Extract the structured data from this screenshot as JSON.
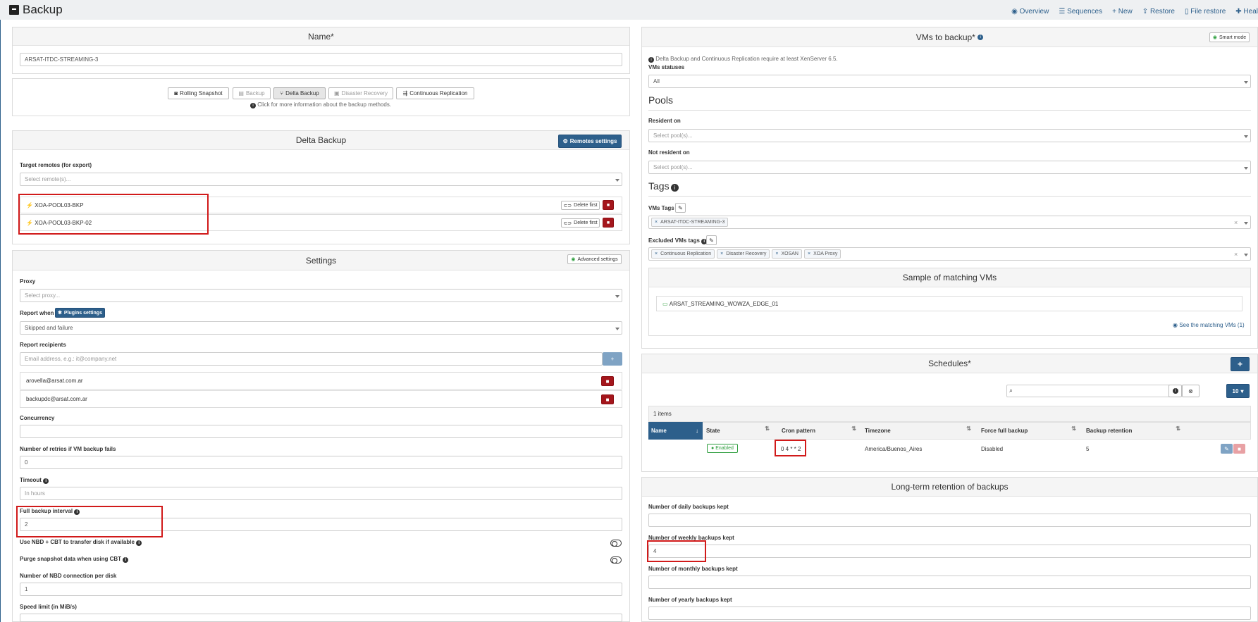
{
  "app": {
    "title": "Backup"
  },
  "nav": {
    "overview": "Overview",
    "sequences": "Sequences",
    "new": "New",
    "restore": "Restore",
    "file_restore": "File restore",
    "health": "Heal"
  },
  "name_panel": {
    "title": "Name*",
    "value": "ARSAT-ITDC-STREAMING-3"
  },
  "modes": {
    "rolling_snapshot": "Rolling Snapshot",
    "backup": "Backup",
    "delta_backup": "Delta Backup",
    "disaster_recovery": "Disaster Recovery",
    "continuous_replication": "Continuous Replication",
    "hint": "Click for more information about the backup methods."
  },
  "delta": {
    "title": "Delta Backup",
    "remotes_settings": "Remotes settings",
    "target_label": "Target remotes (for export)",
    "target_placeholder": "Select remote(s)...",
    "remotes": [
      {
        "name": "XOA-POOL03-BKP",
        "delete_first": "Delete first"
      },
      {
        "name": "XOA-POOL03-BKP-02",
        "delete_first": "Delete first"
      }
    ]
  },
  "settings": {
    "title": "Settings",
    "advanced": "Advanced settings",
    "proxy_label": "Proxy",
    "proxy_placeholder": "Select proxy...",
    "report_when_label": "Report when",
    "plugins_settings": "Plugins settings",
    "report_when_value": "Skipped and failure",
    "recipients_label": "Report recipients",
    "recipients_placeholder": "Email address, e.g.: it@company.net",
    "recipients": [
      "arovella@arsat.com.ar",
      "backupdc@arsat.com.ar"
    ],
    "concurrency_label": "Concurrency",
    "concurrency_value": "",
    "retries_label": "Number of retries if VM backup fails",
    "retries_value": "0",
    "timeout_label": "Timeout",
    "timeout_placeholder": "In hours",
    "full_interval_label": "Full backup interval",
    "full_interval_value": "2",
    "nbd_label": "Use NBD + CBT to transfer disk if available",
    "purge_label": "Purge snapshot data when using CBT",
    "nbd_conn_label": "Number of NBD connection per disk",
    "nbd_conn_value": "1",
    "speed_label": "Speed limit (in MiB/s)"
  },
  "vms": {
    "title": "VMs to backup*",
    "smart_mode": "Smart mode",
    "note": "Delta Backup and Continuous Replication require at least XenServer 6.5.",
    "statuses_label": "VMs statuses",
    "statuses_value": "All",
    "pools_heading": "Pools",
    "resident_label": "Resident on",
    "resident_placeholder": "Select pool(s)...",
    "not_resident_label": "Not resident on",
    "not_resident_placeholder": "Select pool(s)...",
    "tags_heading": "Tags",
    "vm_tags_label": "VMs Tags",
    "vm_tags": [
      "ARSAT-ITDC-STREAMING-3"
    ],
    "excluded_label": "Excluded VMs tags",
    "excluded_tags": [
      "Continuous Replication",
      "Disaster Recovery",
      "XOSAN",
      "XOA Proxy"
    ],
    "sample_title": "Sample of matching VMs",
    "sample_vm": "ARSAT_STREAMING_WOWZA_EDGE_01",
    "see_matching": "See the matching VMs (1)"
  },
  "schedules": {
    "title": "Schedules*",
    "page_size": "10",
    "count": "1 items",
    "columns": [
      "Name",
      "State",
      "Cron pattern",
      "Timezone",
      "Force full backup",
      "Backup retention"
    ],
    "rows": [
      {
        "name": "",
        "state": "Enabled",
        "cron": "0 4 * * 2",
        "timezone": "America/Buenos_Aires",
        "force_full": "Disabled",
        "retention": "5"
      }
    ]
  },
  "ltr": {
    "title": "Long-term retention of backups",
    "daily_label": "Number of daily backups kept",
    "daily_value": "",
    "weekly_label": "Number of weekly backups kept",
    "weekly_value": "4",
    "monthly_label": "Number of monthly backups kept",
    "monthly_value": "",
    "yearly_label": "Number of yearly backups kept",
    "yearly_value": ""
  },
  "colors": {
    "primary": "#2d5f8b",
    "danger": "#a4161c",
    "highlight": "#d11a1a",
    "enabled": "#2e9e3e"
  }
}
